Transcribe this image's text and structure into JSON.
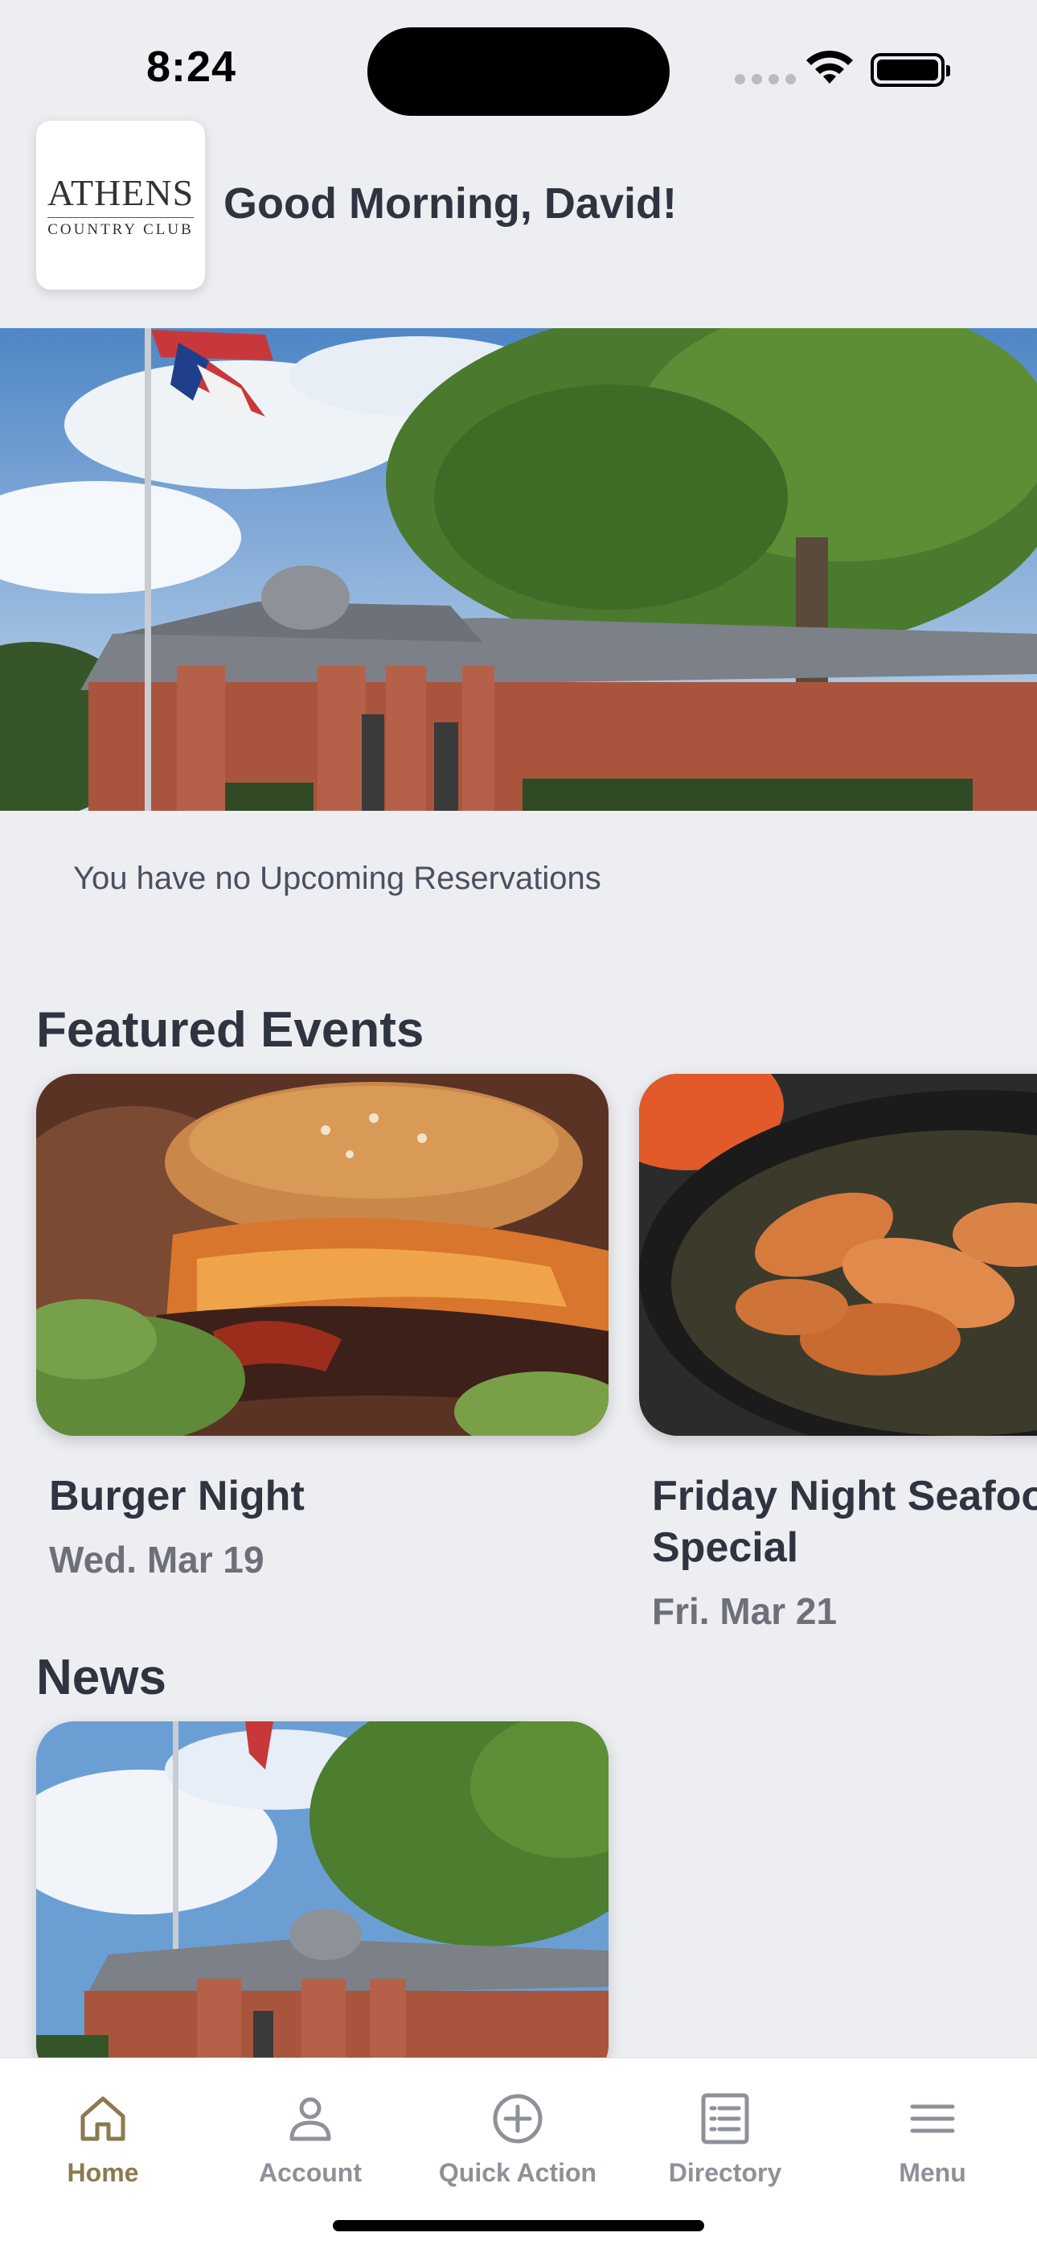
{
  "status_bar": {
    "time": "8:24"
  },
  "header": {
    "logo_main": "ATHENS",
    "logo_sub": "COUNTRY CLUB",
    "greeting": "Good Morning, David!"
  },
  "reservations": {
    "empty_text": "You have no Upcoming Reservations"
  },
  "featured_events": {
    "title": "Featured Events",
    "items": [
      {
        "name": "Burger Night",
        "date": "Wed. Mar 19",
        "image_icon": "burger-photo"
      },
      {
        "name_line1": "Friday Night Seafood",
        "name_line2": "Special",
        "date": "Fri. Mar 21",
        "image_icon": "shrimp-photo"
      }
    ]
  },
  "news": {
    "title": "News",
    "image_icon": "clubhouse-photo"
  },
  "tab_bar": {
    "active_color": "#8b7a4e",
    "items": [
      {
        "label": "Home",
        "icon": "home-icon"
      },
      {
        "label": "Account",
        "icon": "person-icon"
      },
      {
        "label": "Quick Action",
        "icon": "plus-circle-icon"
      },
      {
        "label": "Directory",
        "icon": "list-icon"
      },
      {
        "label": "Menu",
        "icon": "hamburger-icon"
      }
    ]
  }
}
